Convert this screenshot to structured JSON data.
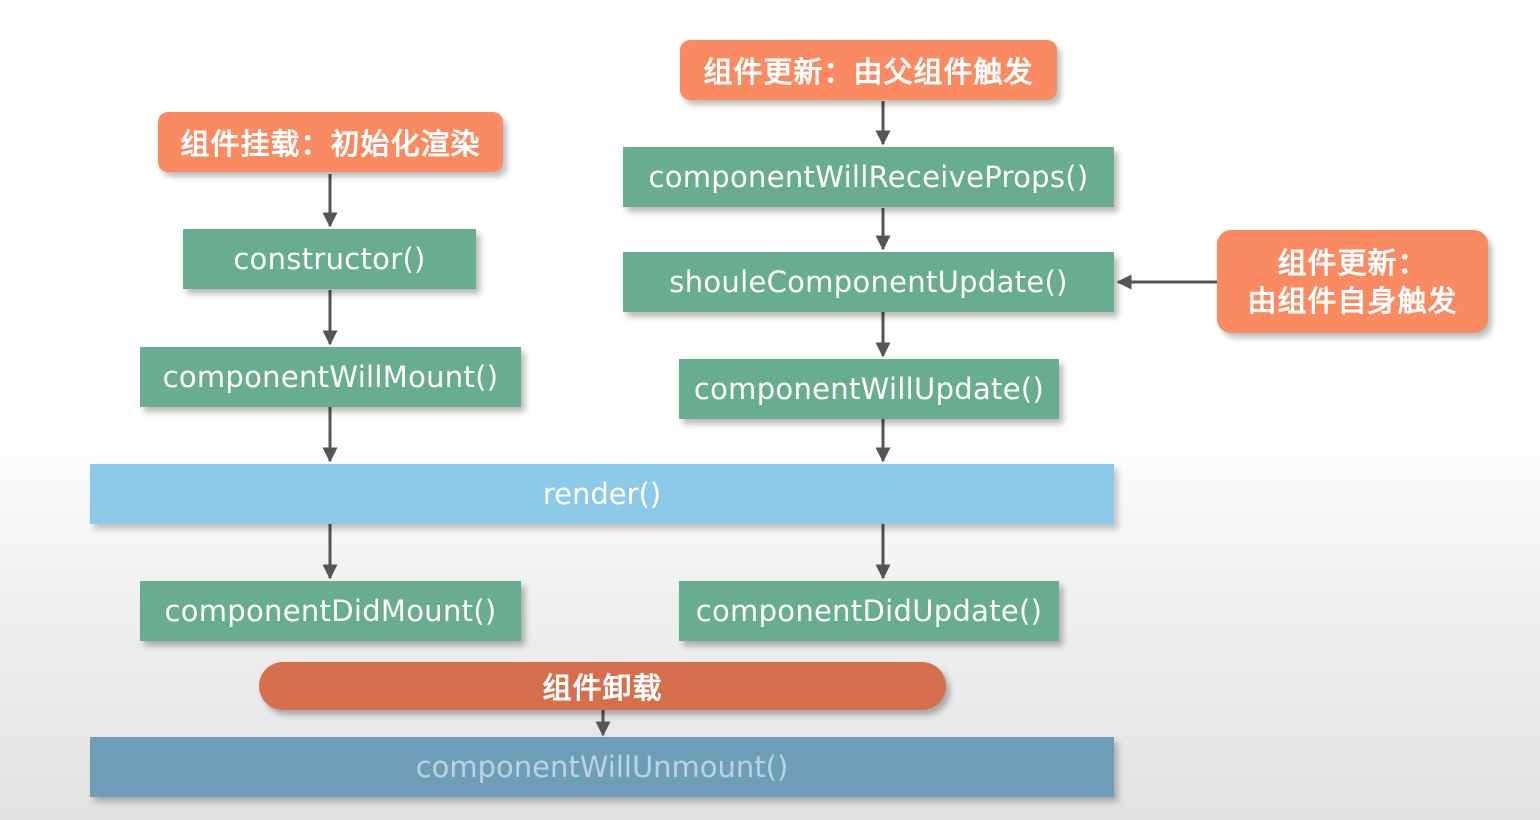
{
  "mount": {
    "trigger": "组件挂载：初始化渲染",
    "constructor": "constructor()",
    "will_mount": "componentWillMount()",
    "did_mount": "componentDidMount()"
  },
  "update": {
    "parent_trigger": "组件更新：由父组件触发",
    "will_receive_props": "componentWillReceiveProps()",
    "should_update": "shouleComponentUpdate()",
    "will_update": "componentWillUpdate()",
    "did_update": "componentDidUpdate()",
    "self_trigger_line1": "组件更新：",
    "self_trigger_line2": "由组件自身触发"
  },
  "render": "render()",
  "unmount": {
    "trigger": "组件卸载",
    "will_unmount": "componentWillUnmount()"
  },
  "colors": {
    "lifecycle_box": "#68ad8f",
    "trigger_box": "#f98a62",
    "render_bar": "#8dc9e8",
    "unmount_pill": "#d66f4c",
    "unmount_bar": "#6e9db8",
    "arrow": "#555555"
  }
}
